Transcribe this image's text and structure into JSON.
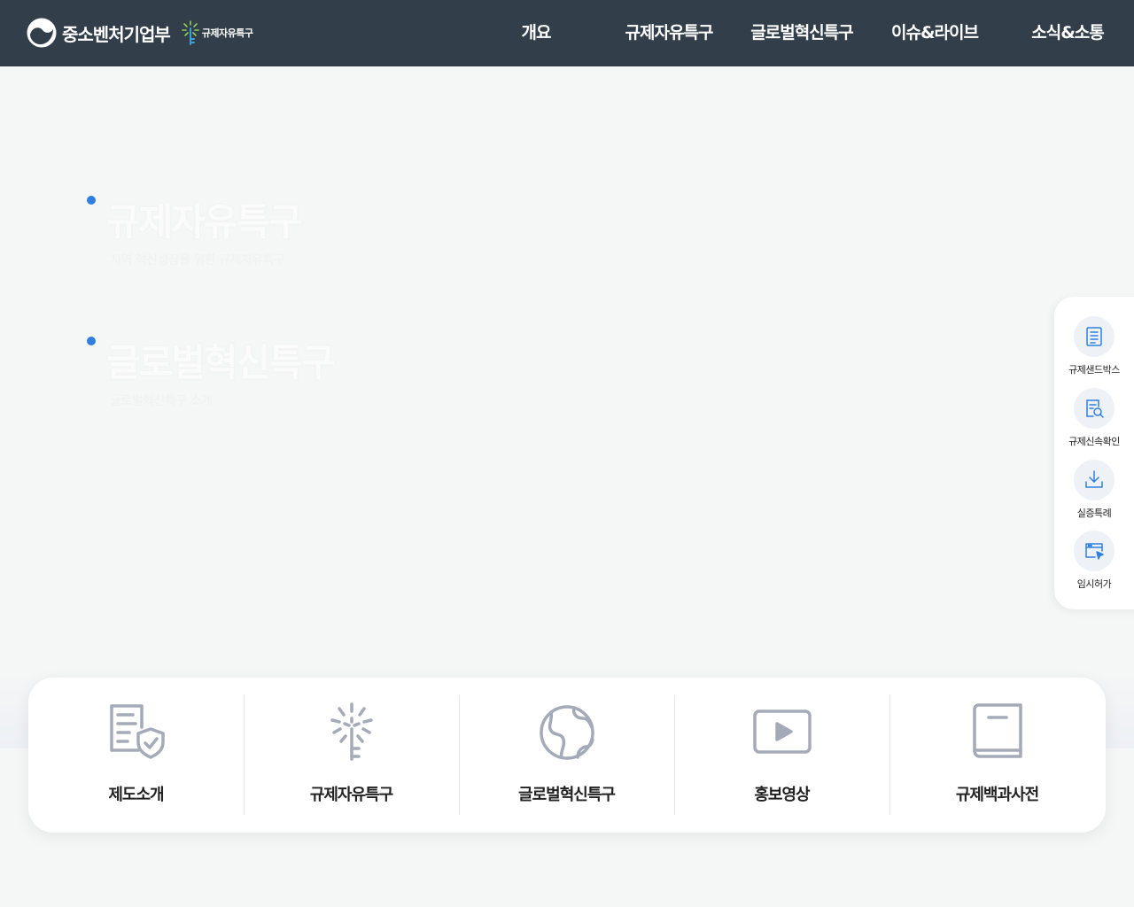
{
  "header": {
    "ministry_name": "중소벤처기업부",
    "sub_brand": "규제자유특구",
    "nav": [
      {
        "label": "개요"
      },
      {
        "label": "규제자유특구"
      },
      {
        "label": "글로벌혁신특구"
      },
      {
        "label": "이슈&라이브"
      },
      {
        "label": "소식&소통"
      }
    ]
  },
  "hero": {
    "slides": [
      {
        "title": "규제자유특구",
        "subtitle": "지역 혁신성장을 위한 규제자유특구"
      },
      {
        "title": "글로벌혁신특구",
        "subtitle": "글로벌혁신특구 소개"
      }
    ],
    "accent_color": "#2f7fe0"
  },
  "quick_menu": {
    "items": [
      {
        "label": "규제샌드박스",
        "icon": "document-list-icon"
      },
      {
        "label": "규제신속확인",
        "icon": "document-search-icon"
      },
      {
        "label": "실증특례",
        "icon": "download-tray-icon"
      },
      {
        "label": "임시허가",
        "icon": "browser-cursor-icon"
      }
    ],
    "icon_color": "#2f7fe0"
  },
  "shortcuts": {
    "items": [
      {
        "label": "제도소개",
        "icon": "document-shield-icon"
      },
      {
        "label": "규제자유특구",
        "icon": "sparkle-key-icon"
      },
      {
        "label": "글로벌혁신특구",
        "icon": "globe-icon"
      },
      {
        "label": "홍보영상",
        "icon": "video-play-icon"
      },
      {
        "label": "규제백과사전",
        "icon": "book-icon"
      }
    ],
    "icon_color": "#a4aab8"
  }
}
